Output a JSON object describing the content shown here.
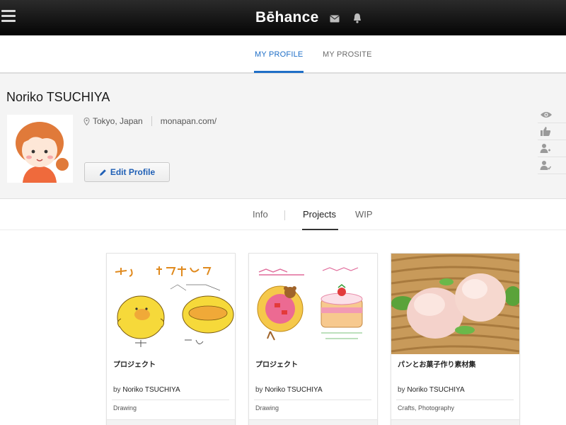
{
  "topbar": {
    "brand": "Bēhance",
    "menu_icon": "hamburger-menu-icon",
    "mail_icon": "mail-icon",
    "bell_icon": "bell-icon"
  },
  "subnav": {
    "tabs": [
      {
        "label": "MY PROFILE",
        "active": true
      },
      {
        "label": "MY PROSITE",
        "active": false
      }
    ]
  },
  "profile": {
    "name": "Noriko TSUCHIYA",
    "location": "Tokyo, Japan",
    "website": "monapan.com/",
    "edit_label": "Edit Profile",
    "side_icons": [
      "eye-icon",
      "thumbs-up-icon",
      "follow-user-icon",
      "following-user-icon"
    ]
  },
  "content_tabs": [
    {
      "label": "Info",
      "active": false
    },
    {
      "label": "Projects",
      "active": true
    },
    {
      "label": "WIP",
      "active": false
    }
  ],
  "projects": [
    {
      "title": "プロジェクト",
      "by": "by",
      "author": "Noriko TSUCHIYA",
      "fields": "Drawing"
    },
    {
      "title": "プロジェクト",
      "by": "by",
      "author": "Noriko TSUCHIYA",
      "fields": "Drawing"
    },
    {
      "title": "パンとお菓子作り素材集",
      "by": "by",
      "author": "Noriko TSUCHIYA",
      "fields": "Crafts, Photography"
    }
  ],
  "colors": {
    "accent": "#1f6fc7",
    "topbar": "#111111"
  }
}
